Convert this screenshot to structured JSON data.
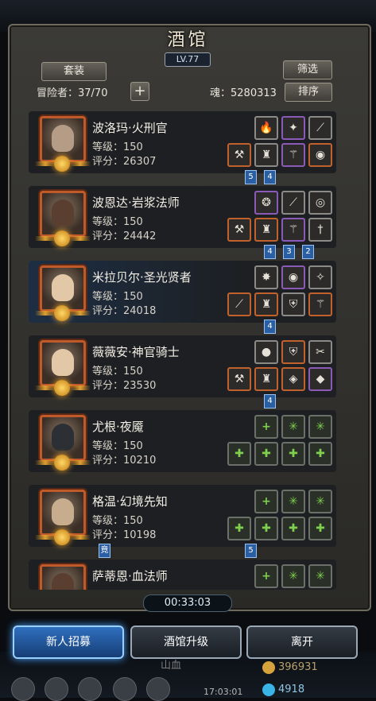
{
  "window": {
    "title": "酒馆",
    "level": "LV.77"
  },
  "toolbar": {
    "outfit_label": "套装",
    "filter_label": "筛选",
    "sort_label": "排序",
    "adventurers_label": "冒险者：37/70",
    "soul_label": "魂：5280313",
    "add_symbol": "+"
  },
  "heroes": [
    {
      "name": "波洛玛·火刑官",
      "level": "等级：150",
      "score": "评分：26307",
      "portrait": "demon-warrior"
    },
    {
      "name": "波恩达·岩浆法师",
      "level": "等级：150",
      "score": "评分：24442",
      "portrait": "dark-skinned-mage"
    },
    {
      "name": "米拉贝尔·圣光贤者",
      "level": "等级：150",
      "score": "评分：24018",
      "portrait": "blonde-sage"
    },
    {
      "name": "薇薇安·神官骑士",
      "level": "等级：150",
      "score": "评分：23530",
      "portrait": "blonde-knight"
    },
    {
      "name": "尤根·夜魇",
      "level": "等级：150",
      "score": "评分：10210",
      "portrait": "masked-assassin"
    },
    {
      "name": "格温·幻境先知",
      "level": "等级：150",
      "score": "评分：10198",
      "portrait": "old-bearded-sage"
    },
    {
      "name": "萨蒂恩·血法师",
      "level": "",
      "score": "",
      "portrait": "dark-skinned-mage"
    }
  ],
  "link_badges": {
    "row1": [
      "5",
      "4"
    ],
    "row2": [
      "4",
      "3",
      "2"
    ],
    "row3": [
      "4"
    ],
    "row4": [
      "4"
    ],
    "row6_left": "竟",
    "row6_right": "5"
  },
  "footer": {
    "timer": "00:33:03",
    "recruit_label": "新人招募",
    "upgrade_label": "酒馆升级",
    "leave_label": "离开",
    "resource_gold": "396931",
    "resource_gem": "4918",
    "partial_text_left": "山血",
    "partial_clock": "17:03:01"
  },
  "colors": {
    "accent_blue": "#2f6fbf",
    "frame_orange": "#c05a2a",
    "link_blue": "#2a5fa3",
    "empty_slot_green": "#7ed04e"
  }
}
